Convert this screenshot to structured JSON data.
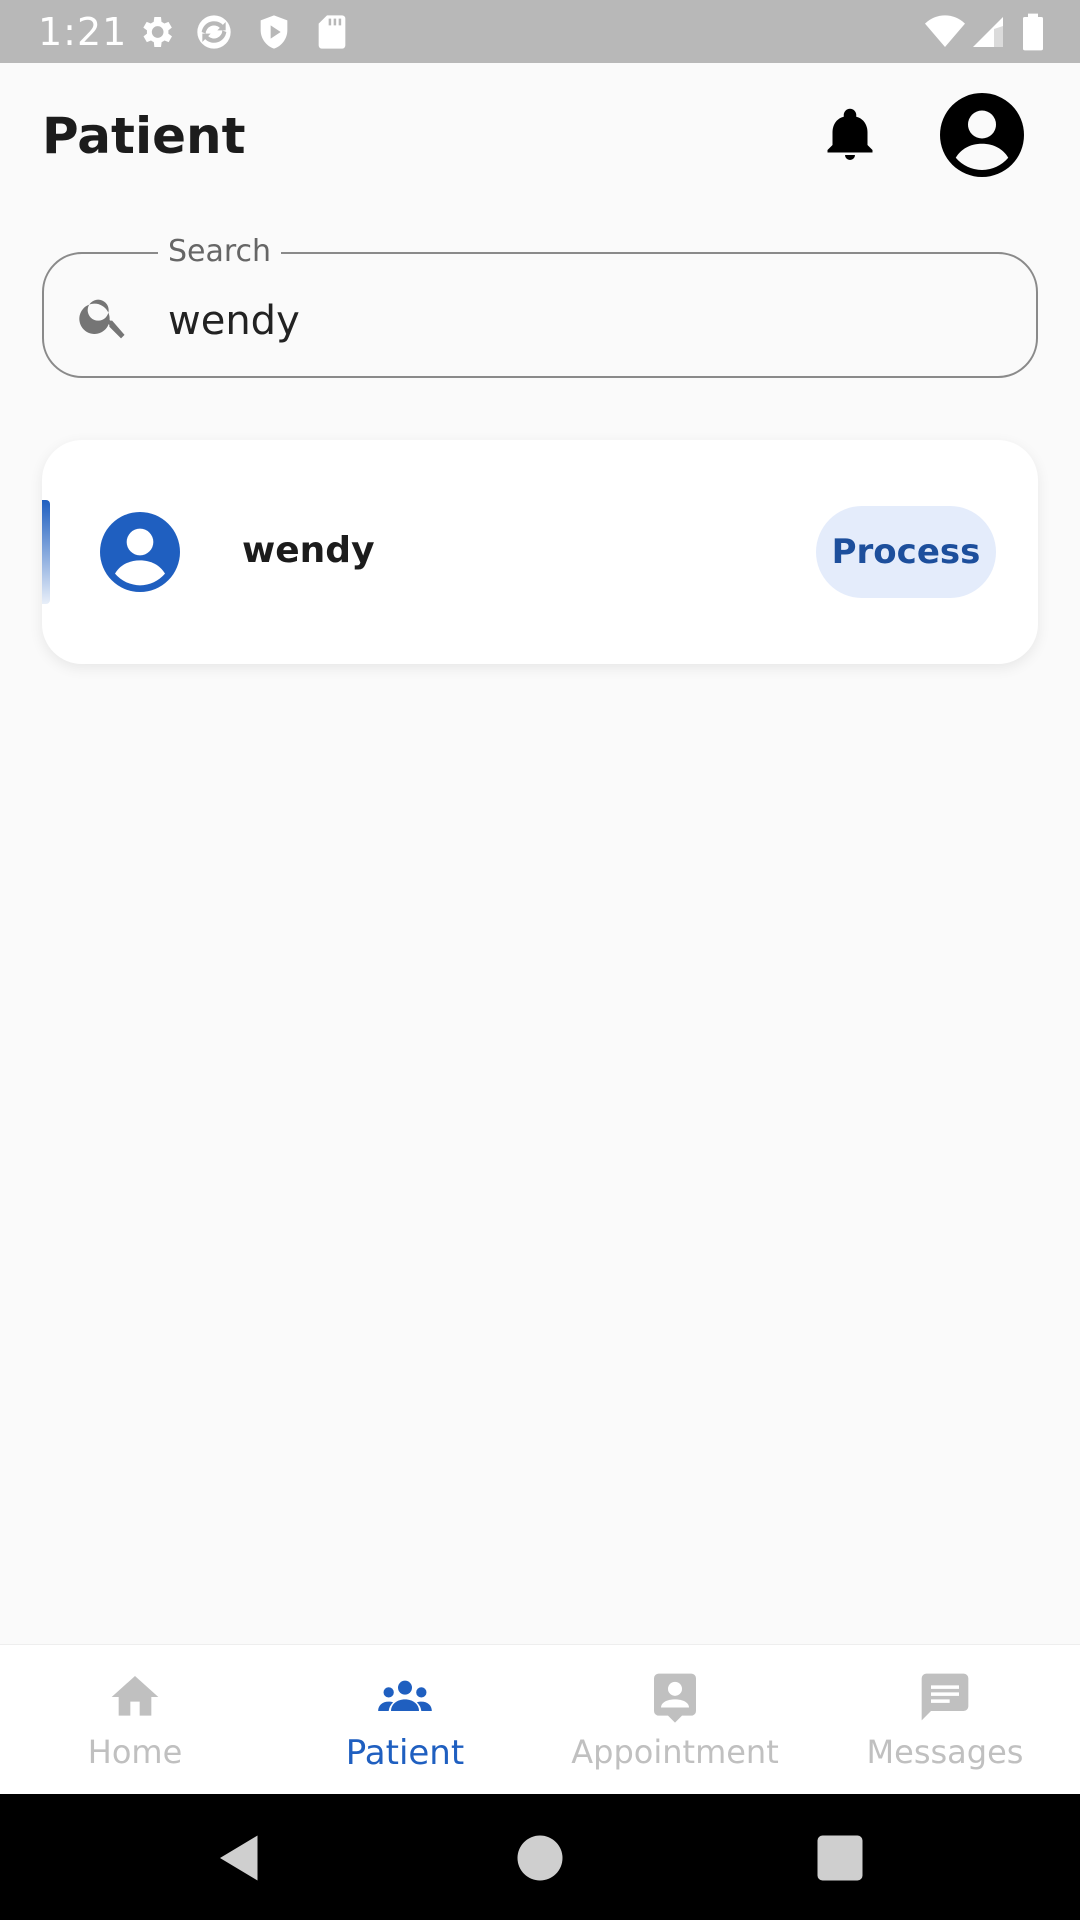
{
  "status_bar": {
    "time": "1:21",
    "icons_left": [
      "settings-gear-icon",
      "sync-app-icon",
      "shield-play-icon",
      "sd-card-icon"
    ],
    "icons_right": [
      "wifi-icon",
      "signal-icon",
      "battery-icon"
    ]
  },
  "header": {
    "title": "Patient",
    "icons": [
      "bell-icon",
      "account-circle-icon"
    ]
  },
  "search": {
    "label": "Search",
    "value": "wendy"
  },
  "results": [
    {
      "name": "wendy",
      "action_label": "Process"
    }
  ],
  "bottom_nav": {
    "items": [
      {
        "label": "Home",
        "icon": "home-icon",
        "active": false
      },
      {
        "label": "Patient",
        "icon": "people-icon",
        "active": true
      },
      {
        "label": "Appointment",
        "icon": "contact-card-icon",
        "active": false
      },
      {
        "label": "Messages",
        "icon": "message-icon",
        "active": false
      }
    ]
  },
  "colors": {
    "accent": "#1f5fc0",
    "process_bg": "#e4ecfb",
    "process_text": "#1d4f9c",
    "inactive_nav": "#c0c0c0",
    "status_bar": "#b8b8b8"
  }
}
